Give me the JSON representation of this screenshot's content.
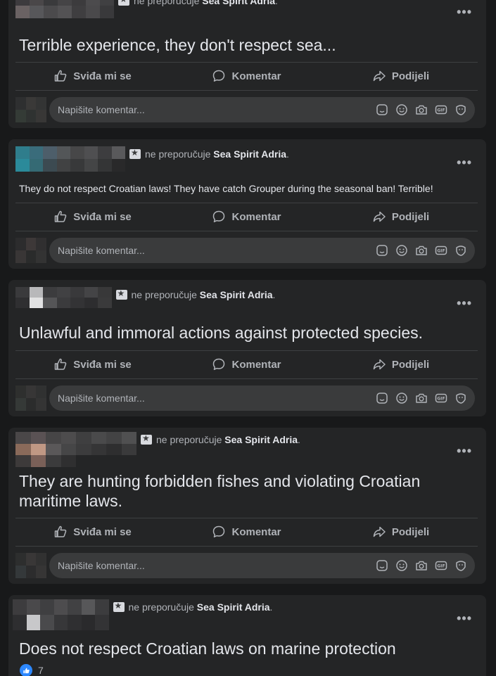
{
  "common": {
    "recommend_text": "ne preporučuje",
    "page_name": "Sea Spirit Adria",
    "period": ".",
    "more": "•••",
    "like_label": "Sviđa mi se",
    "comment_label": "Komentar",
    "share_label": "Podijeli",
    "comment_placeholder": "Napišite komentar..."
  },
  "posts": [
    {
      "text": "Terrible experience, they don't respect sea..."
    },
    {
      "text": "They do not respect Croatian laws! They have catch Grouper during the seasonal ban! Terrible!"
    },
    {
      "text": "Unlawful and immoral actions against protected species."
    },
    {
      "text": "They are hunting forbidden fishes and violating Croatian maritime laws."
    },
    {
      "text": "Does not respect Croatian laws on marine protection",
      "reaction_count": "7"
    }
  ],
  "comment_icons": [
    "sticker-icon",
    "emoji-icon",
    "camera-icon",
    "gif-icon",
    "avatar-sticker-icon"
  ],
  "colors": {
    "background": "#18191a",
    "card": "#242526",
    "input": "#3a3b3c",
    "secondary_text": "#b0b3b8",
    "primary_text": "#e4e6eb",
    "like_blue": "#2d88ff"
  }
}
